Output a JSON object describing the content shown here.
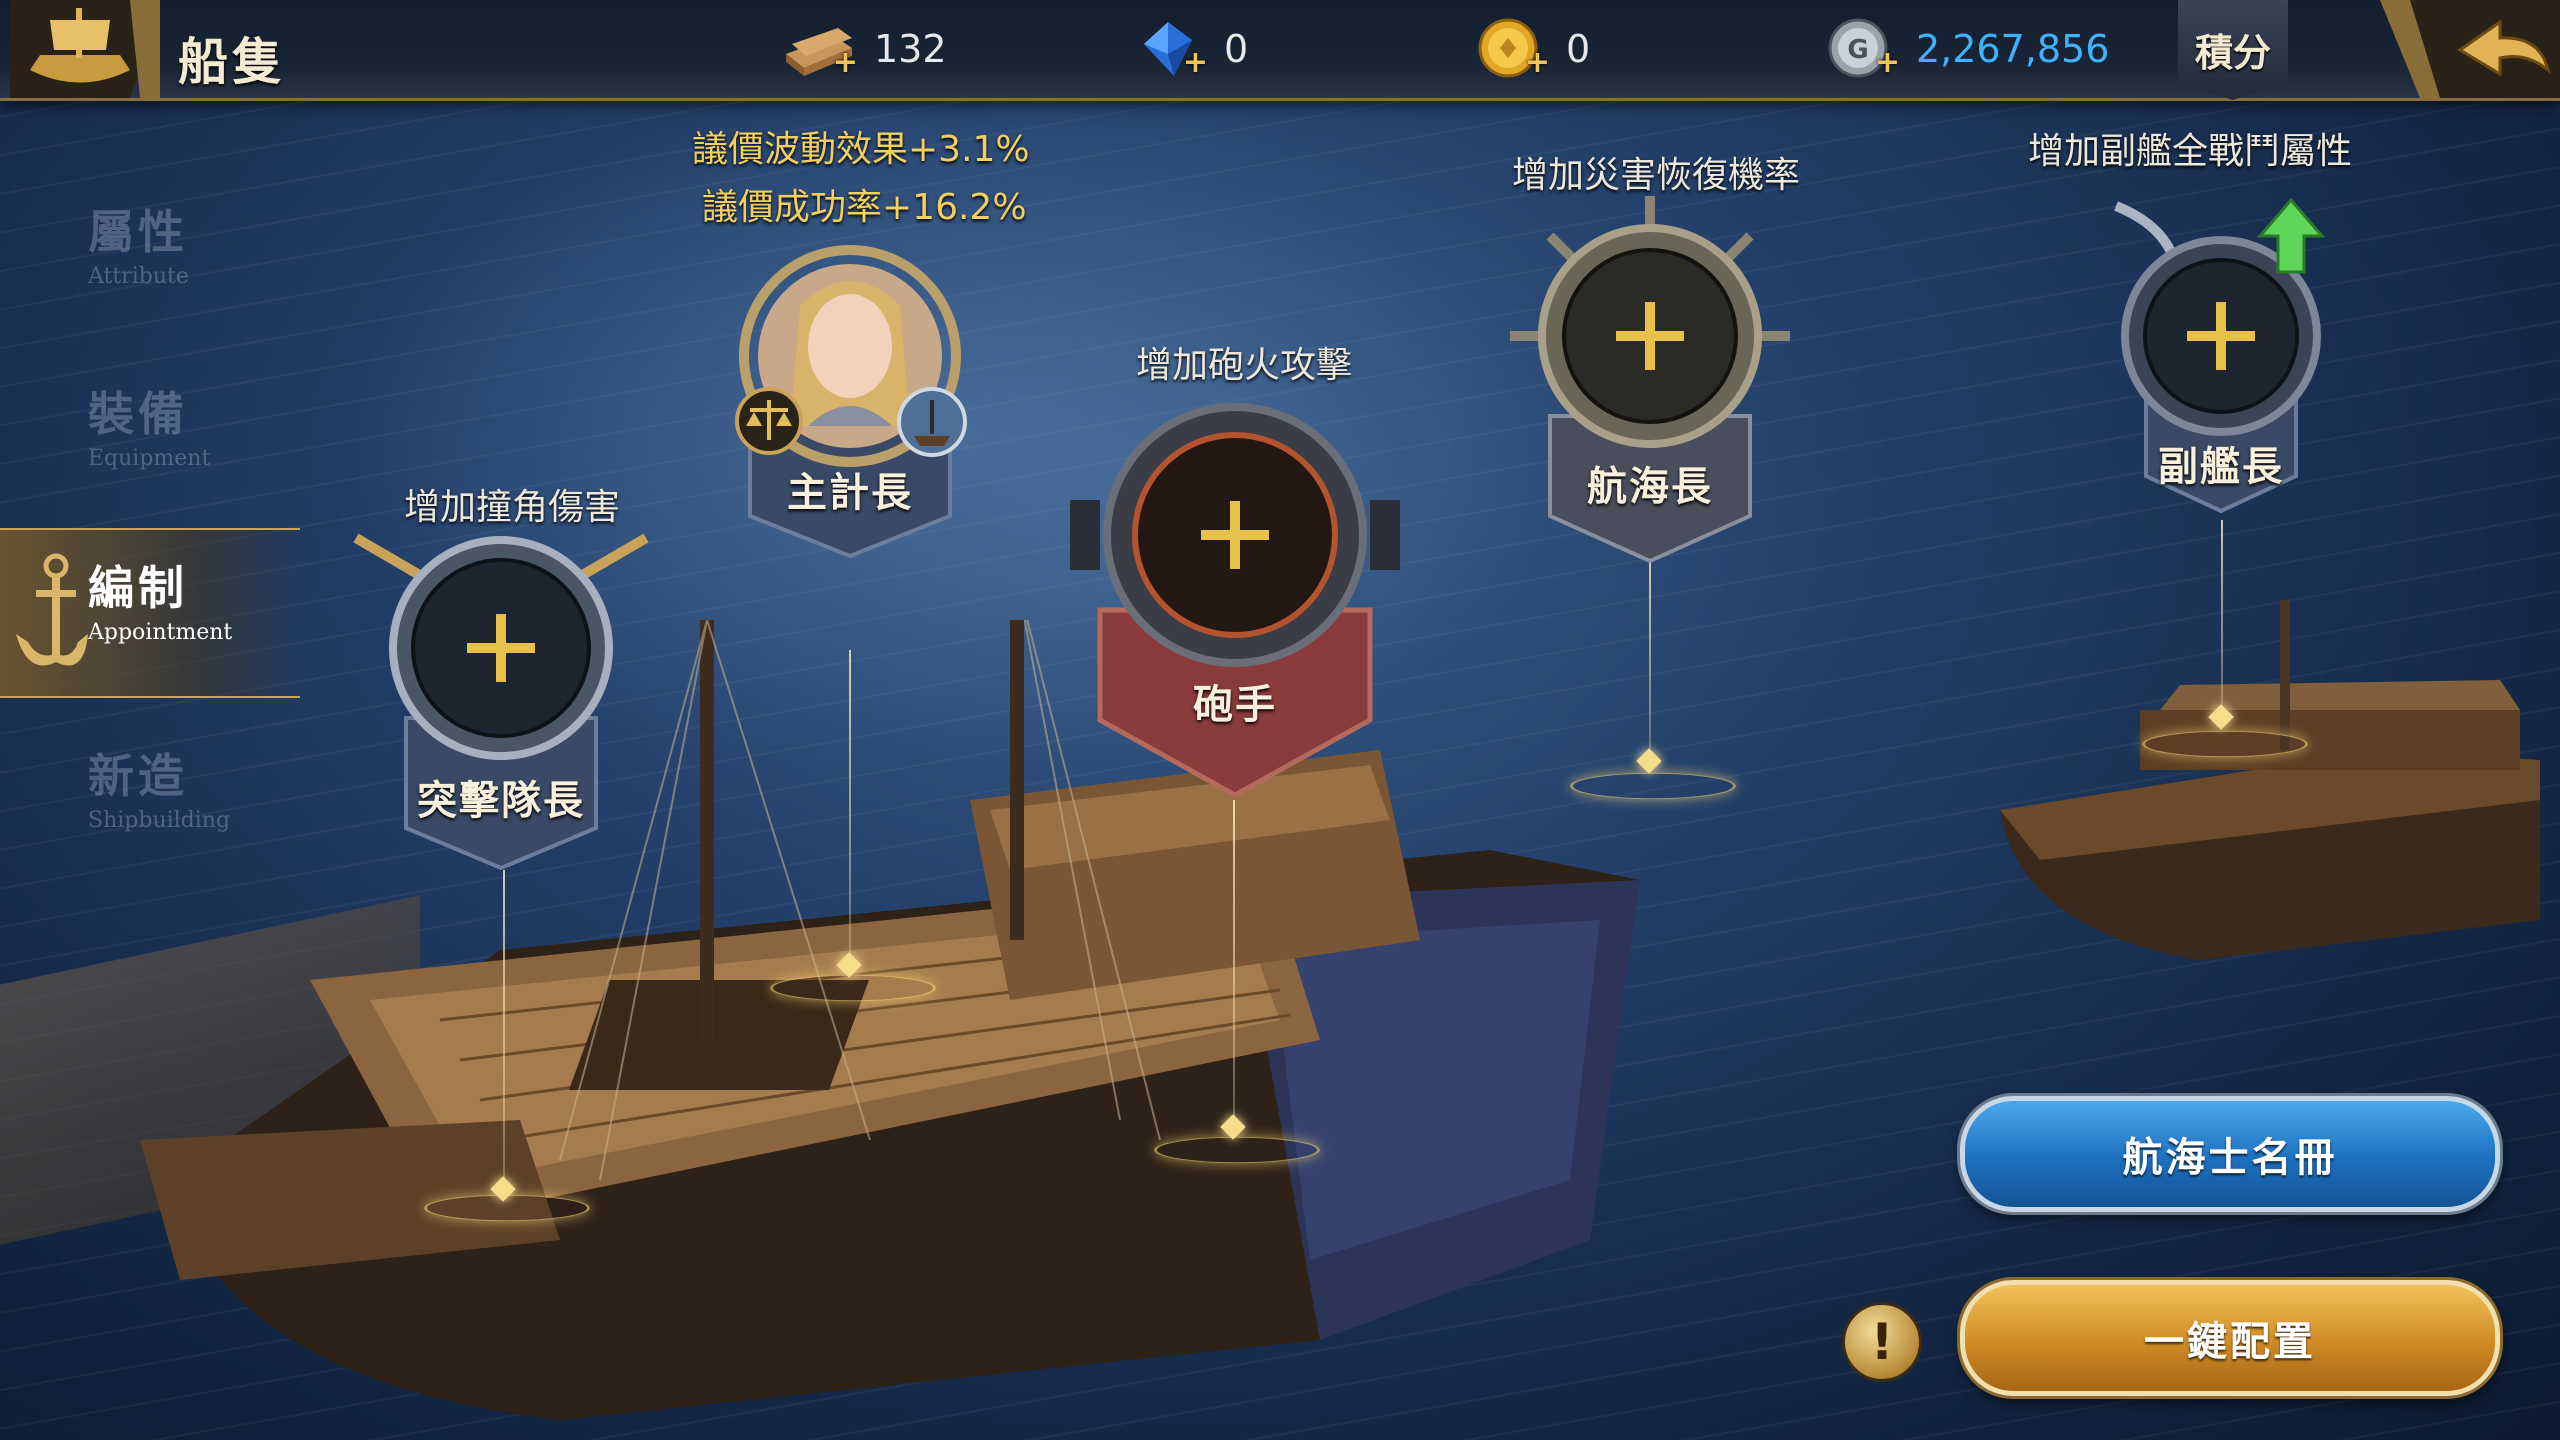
{
  "header": {
    "title": "船隻",
    "resources": [
      {
        "icon": "wood-planks-icon",
        "value": "132"
      },
      {
        "icon": "blue-gem-icon",
        "value": "0"
      },
      {
        "icon": "gold-coin-icon",
        "value": "0"
      },
      {
        "icon": "silver-coin-icon",
        "value": "2,267,856"
      }
    ],
    "score_label": "積分"
  },
  "sidebar": {
    "items": [
      {
        "cn": "屬性",
        "en": "Attribute"
      },
      {
        "cn": "裝備",
        "en": "Equipment"
      },
      {
        "cn": "編制",
        "en": "Appointment",
        "active": true
      },
      {
        "cn": "新造",
        "en": "Shipbuilding"
      }
    ]
  },
  "slots": {
    "raider": {
      "label": "突擊隊長",
      "bonus": "增加撞角傷害"
    },
    "purser": {
      "label": "主計長",
      "bonus_line1_prefix": "議價波動效果",
      "bonus_line1_value": "+3.1%",
      "bonus_line2_prefix": "議價成功率",
      "bonus_line2_value": "+16.2%"
    },
    "gunner": {
      "label": "砲手",
      "bonus": "增加砲火攻擊"
    },
    "navigator": {
      "label": "航海長",
      "bonus": "增加災害恢復機率"
    },
    "first_mate": {
      "label": "副艦長",
      "bonus": "增加副艦全戰鬥屬性"
    }
  },
  "buttons": {
    "roster": "航海士名冊",
    "auto_assign": "一鍵配置",
    "info": "!"
  },
  "colors": {
    "accent_gold": "#f2cf5f",
    "resource_blue": "#3fb2ff",
    "gunner_banner": "#8a3b3b",
    "slot_banner": "#3a4a66"
  }
}
